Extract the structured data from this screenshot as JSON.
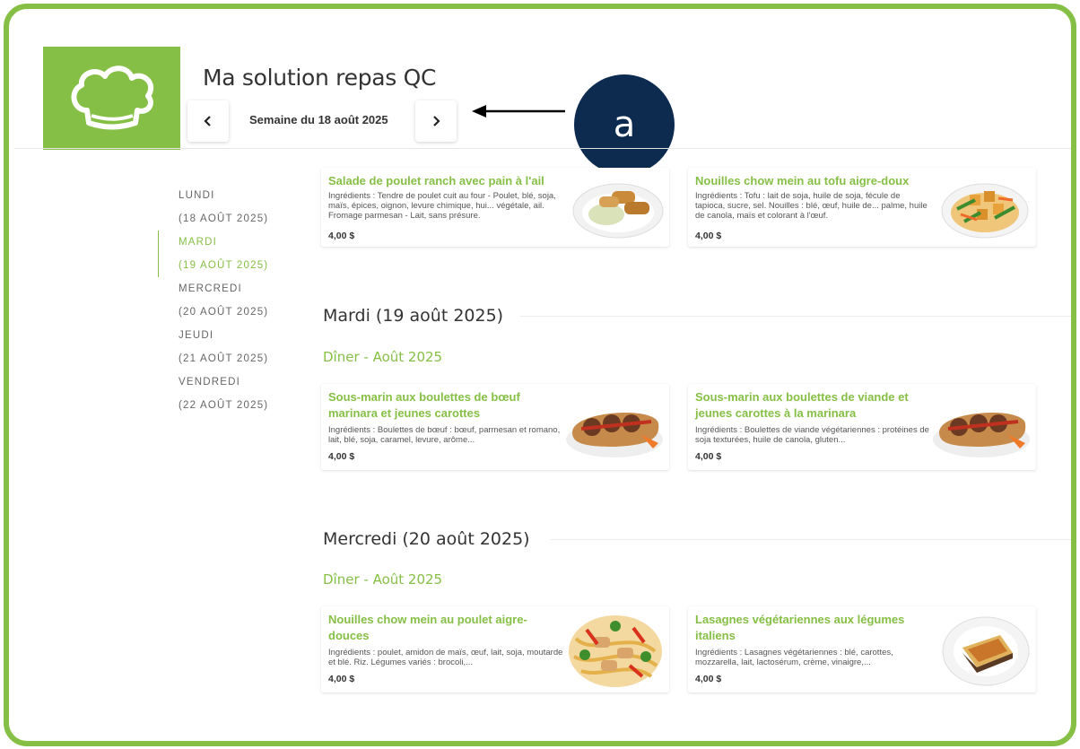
{
  "header": {
    "app_title": "Ma solution repas QC",
    "week_label": "Semaine du 18 août 2025",
    "prev_icon": "chevron-left-icon",
    "next_icon": "chevron-right-icon",
    "callout_label": "a"
  },
  "colors": {
    "brand_green": "#86bf45",
    "callout_navy": "#0d2b4e"
  },
  "sidebar": {
    "days": [
      {
        "name": "LUNDI",
        "date": "(18 AOÛT 2025)",
        "active": false
      },
      {
        "name": "MARDI",
        "date": "(19 AOÛT 2025)",
        "active": true
      },
      {
        "name": "MERCREDI",
        "date": "(20 AOÛT 2025)",
        "active": false
      },
      {
        "name": "JEUDI",
        "date": "(21 AOÛT 2025)",
        "active": false
      },
      {
        "name": "VENDREDI",
        "date": "(22 AOÛT 2025)",
        "active": false
      }
    ]
  },
  "monday": {
    "items": [
      {
        "title": "Salade de poulet ranch avec pain à l'ail",
        "ingredients": "Ingrédients : Tendre de poulet cuit au four - Poulet, blé, soja, maïs, épices, oignon, levure chimique, hui... végétale, ail. Fromage parmesan - Lait, sans présure.",
        "price": "4,00 $"
      },
      {
        "title": "Nouilles chow mein au tofu aigre-doux",
        "ingredients": "Ingrédients : Tofu : lait de soja, huile de soja, fécule de tapioca, sucre, sel. Nouilles : blé, œuf, huile de... palme, huile de canola, maïs et colorant à l'œuf.",
        "price": "4,00 $"
      }
    ]
  },
  "tuesday": {
    "heading": "Mardi (19 août 2025)",
    "subheading": "Dîner - Août 2025",
    "items": [
      {
        "title": "Sous-marin aux boulettes de bœuf marinara et jeunes carottes",
        "ingredients": "Ingrédients : Boulettes de bœuf : bœuf, parmesan et romano, lait, blé, soja, caramel, levure, arôme...",
        "price": "4,00 $"
      },
      {
        "title": "Sous-marin aux boulettes de viande et jeunes carottes à la marinara",
        "ingredients": "Ingrédients : Boulettes de viande végétariennes : protéines de soja texturées, huile de canola, gluten...",
        "price": "4,00 $"
      }
    ]
  },
  "wednesday": {
    "heading": "Mercredi (20 août 2025)",
    "subheading": "Dîner - Août 2025",
    "items": [
      {
        "title": "Nouilles chow mein au poulet aigre-douces",
        "ingredients": "Ingrédients : poulet, amidon de maïs, œuf, lait, soja, moutarde et blé. Riz. Légumes variés : brocoli,...",
        "price": "4,00 $"
      },
      {
        "title": "Lasagnes végétariennes aux légumes italiens",
        "ingredients": "Ingrédients : Lasagnes végétariennes : blé, carottes, mozzarella, lait, lactosérum, crème, vinaigre,...",
        "price": "4,00 $"
      }
    ]
  }
}
